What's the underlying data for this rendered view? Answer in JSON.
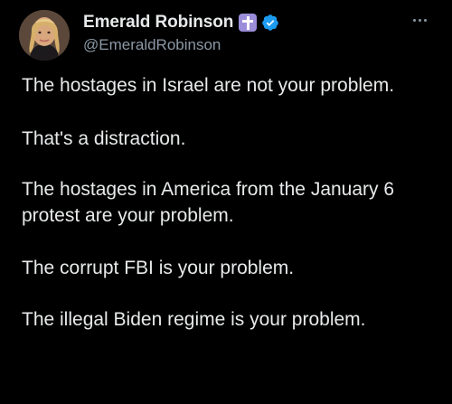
{
  "tweet": {
    "author": {
      "display_name": "Emerald Robinson",
      "handle": "@EmeraldRobinson",
      "badges": [
        "latin-cross-icon",
        "verified-icon"
      ],
      "avatar": "avatar-photo"
    },
    "more_icon": "more-options-icon",
    "paragraphs": [
      "The hostages in Israel are not your problem.",
      "That's a distraction.",
      "The hostages in America from the January 6 protest are your problem.",
      "The corrupt FBI is your problem.",
      "The illegal Biden regime is your problem."
    ]
  },
  "colors": {
    "background": "#000000",
    "text": "#e7e9ea",
    "secondary_text": "#8b98a5",
    "verified_blue": "#1d9bf0",
    "cross_badge": "#9b8dd9"
  }
}
